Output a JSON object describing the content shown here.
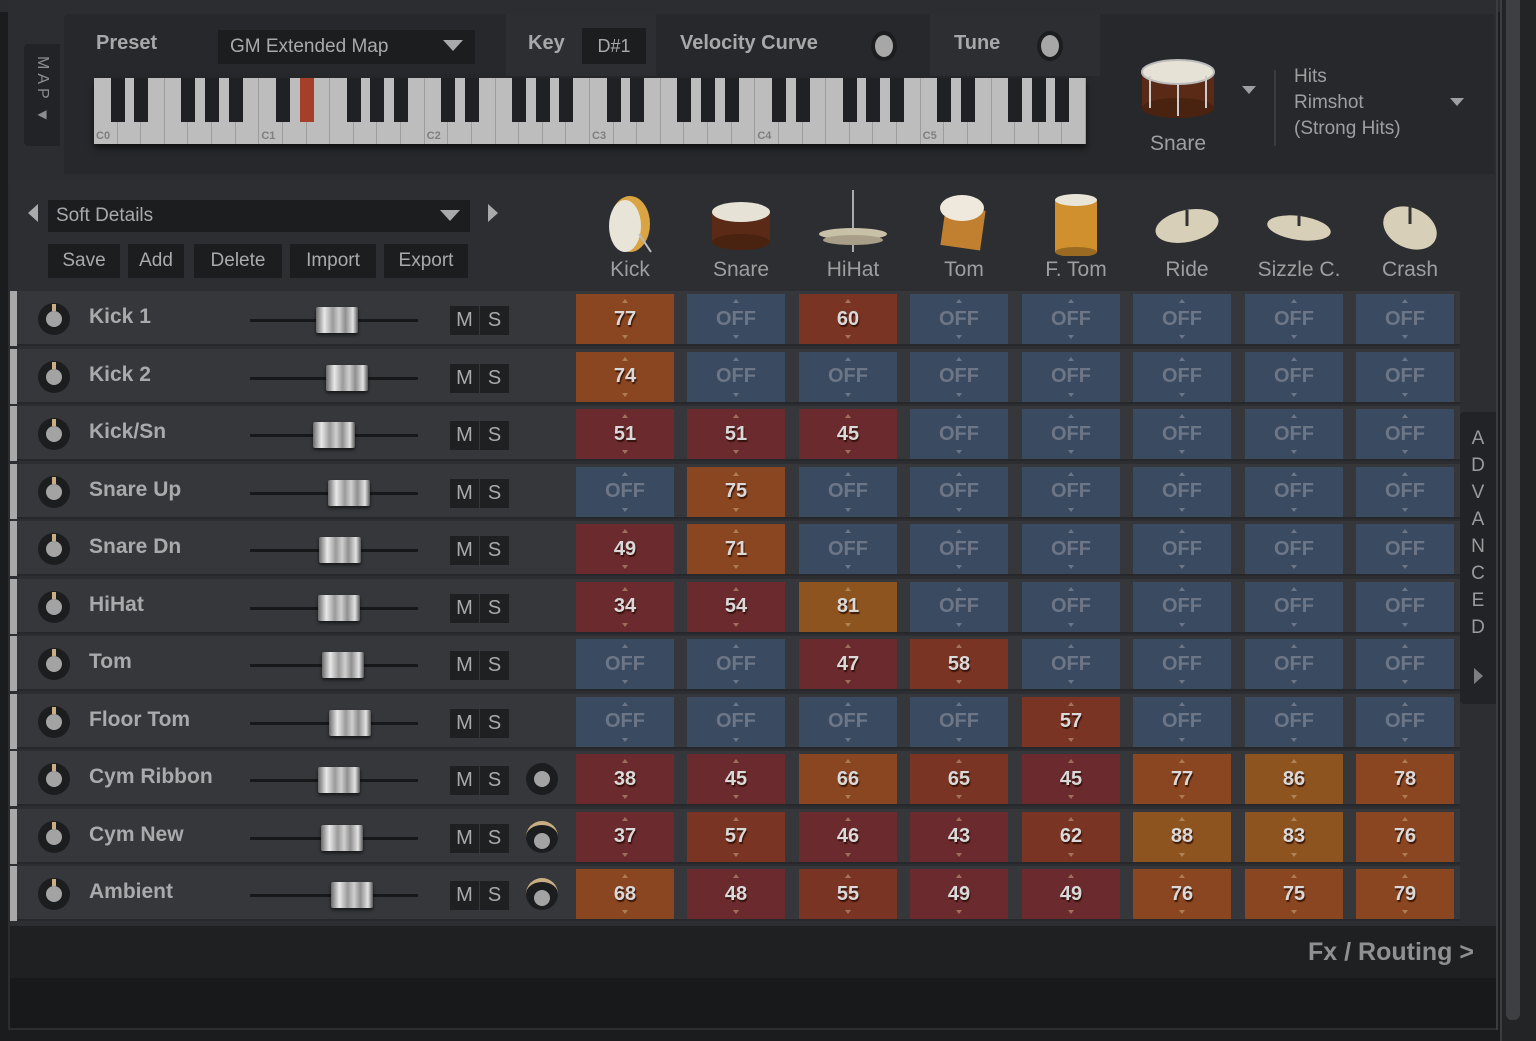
{
  "map": {
    "tab_label": "MAP",
    "preset_label": "Preset",
    "preset_value": "GM Extended Map",
    "key_label": "Key",
    "key_value": "D#1",
    "velocity_curve_label": "Velocity Curve",
    "tune_label": "Tune",
    "octave_labels": [
      "C0",
      "C1",
      "C2",
      "C3",
      "C4",
      "C5"
    ],
    "active_key": "D#1",
    "drum_name": "Snare",
    "articulation": [
      "Hits",
      "Rimshot",
      "(Strong Hits)"
    ]
  },
  "mixer": {
    "preset_value": "Soft Details",
    "buttons": [
      "Save",
      "Add",
      "Delete",
      "Import",
      "Export"
    ],
    "drums": [
      "Kick",
      "Snare",
      "HiHat",
      "Tom",
      "F. Tom",
      "Ride",
      "Sizzle C.",
      "Crash"
    ],
    "mute_label": "M",
    "solo_label": "S",
    "channels": [
      {
        "name": "Kick 1",
        "fader": 0.52,
        "bleed": null,
        "values": [
          "77",
          "OFF",
          "60",
          "OFF",
          "OFF",
          "OFF",
          "OFF",
          "OFF"
        ]
      },
      {
        "name": "Kick 2",
        "fader": 0.6,
        "bleed": null,
        "values": [
          "74",
          "OFF",
          "OFF",
          "OFF",
          "OFF",
          "OFF",
          "OFF",
          "OFF"
        ]
      },
      {
        "name": "Kick/Sn",
        "fader": 0.5,
        "bleed": null,
        "values": [
          "51",
          "51",
          "45",
          "OFF",
          "OFF",
          "OFF",
          "OFF",
          "OFF"
        ]
      },
      {
        "name": "Snare Up",
        "fader": 0.62,
        "bleed": null,
        "values": [
          "OFF",
          "75",
          "OFF",
          "OFF",
          "OFF",
          "OFF",
          "OFF",
          "OFF"
        ]
      },
      {
        "name": "Snare Dn",
        "fader": 0.55,
        "bleed": null,
        "values": [
          "49",
          "71",
          "OFF",
          "OFF",
          "OFF",
          "OFF",
          "OFF",
          "OFF"
        ]
      },
      {
        "name": "HiHat",
        "fader": 0.54,
        "bleed": null,
        "values": [
          "34",
          "54",
          "81",
          "OFF",
          "OFF",
          "OFF",
          "OFF",
          "OFF"
        ]
      },
      {
        "name": "Tom",
        "fader": 0.57,
        "bleed": null,
        "values": [
          "OFF",
          "OFF",
          "47",
          "58",
          "OFF",
          "OFF",
          "OFF",
          "OFF"
        ]
      },
      {
        "name": "Floor Tom",
        "fader": 0.63,
        "bleed": null,
        "values": [
          "OFF",
          "OFF",
          "OFF",
          "OFF",
          "57",
          "OFF",
          "OFF",
          "OFF"
        ]
      },
      {
        "name": "Cym Ribbon",
        "fader": 0.54,
        "bleed": "plain",
        "values": [
          "38",
          "45",
          "66",
          "65",
          "45",
          "77",
          "86",
          "78"
        ]
      },
      {
        "name": "Cym New",
        "fader": 0.56,
        "bleed": "arc",
        "values": [
          "37",
          "57",
          "46",
          "43",
          "62",
          "88",
          "83",
          "76"
        ]
      },
      {
        "name": "Ambient",
        "fader": 0.64,
        "bleed": "arc",
        "values": [
          "68",
          "48",
          "55",
          "49",
          "49",
          "76",
          "75",
          "79"
        ]
      }
    ],
    "advanced_label": "ADVANCED",
    "footer_link": "Fx / Routing  >"
  },
  "colors": {
    "off": "#3a4a61",
    "low": "#6b2a2e",
    "mid": "#7a3424",
    "high": "#8a4620",
    "top": "#8e5420",
    "active_key": "#a4402a"
  }
}
